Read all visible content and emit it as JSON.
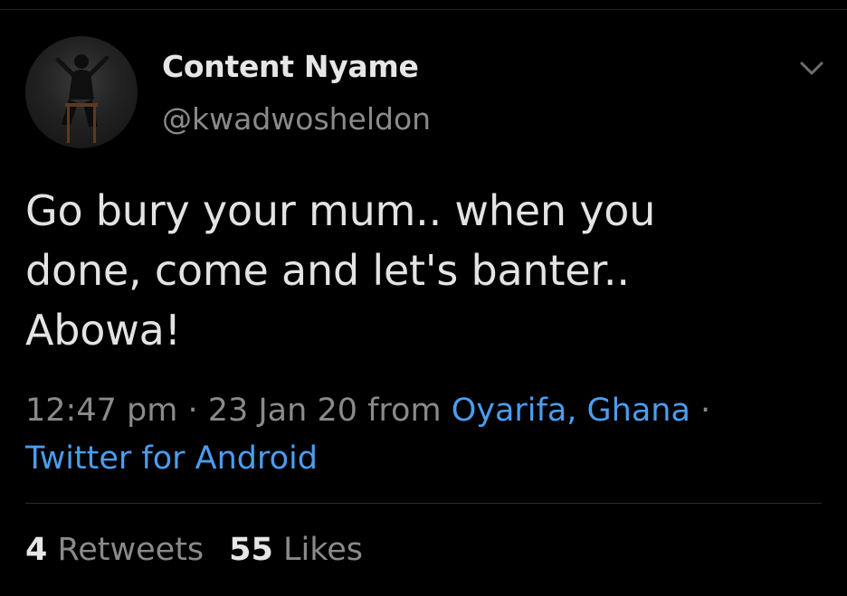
{
  "tweet": {
    "author": {
      "display_name": "Content Nyame",
      "handle": "@kwadwosheldon",
      "avatar_icon": "user-avatar-photo"
    },
    "menu_icon": "chevron-down-icon",
    "text_lines": [
      "Go bury your mum.. when you",
      "done, come and let's banter..",
      "Abowa!"
    ],
    "meta": {
      "time": "12:47 pm",
      "separator1": " · ",
      "date": "23 Jan 20",
      "from_word": " from ",
      "location": "Oyarifa, Ghana",
      "separator2": " · ",
      "source": "Twitter for Android"
    },
    "stats": {
      "retweets_count": "4",
      "retweets_label": "Retweets",
      "likes_count": "55",
      "likes_label": "Likes"
    }
  },
  "colors": {
    "background": "#000000",
    "text_primary": "#e3e3e3",
    "text_secondary": "#8a8a8a",
    "link": "#4a9df0"
  }
}
